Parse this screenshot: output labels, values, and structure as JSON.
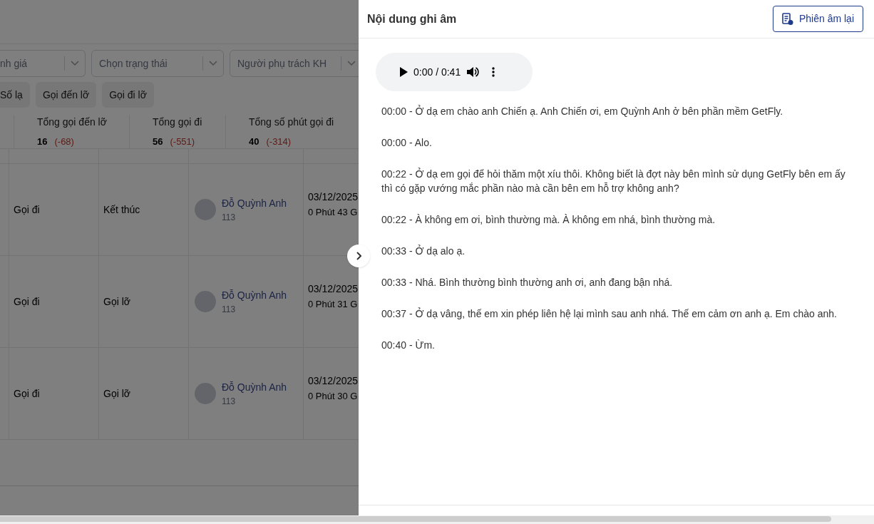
{
  "background_page": {
    "filters": [
      {
        "placeholder": "nh giá"
      },
      {
        "placeholder": "Chọn trạng thái"
      },
      {
        "placeholder": "Người phụ trách KH"
      }
    ],
    "quick_filters": [
      {
        "label": "Số lạ"
      },
      {
        "label": "Gọi đến lỡ"
      },
      {
        "label": "Gọi đi lỡ"
      }
    ],
    "stats": [
      {
        "label": "Tổng gọi đến lỡ",
        "value": "16",
        "change": "(-68)"
      },
      {
        "label": "Tổng gọi đi",
        "value": "56",
        "change": "(-551)"
      },
      {
        "label": "Tổng số phút gọi đi",
        "value": "40",
        "change": "(-314)"
      }
    ],
    "table": {
      "rows": [
        {
          "column_2": "Gọi đi",
          "column_3": "Kết thúc",
          "agent": {
            "name": "Đỗ Quỳnh Anh",
            "extension": "113"
          },
          "column_5": {
            "date": "03/12/2025",
            "duration": "0 Phút 43 G"
          }
        },
        {
          "column_2": "Gọi đi",
          "column_3": "Gọi lỡ",
          "agent": {
            "name": "Đỗ Quỳnh Anh",
            "extension": "113"
          },
          "column_5": {
            "date": "03/12/2025",
            "duration": "0 Phút 31 G"
          }
        },
        {
          "column_2": "Gọi đi",
          "column_3": "Gọi lỡ",
          "agent": {
            "name": "Đỗ Quỳnh Anh",
            "extension": "113"
          },
          "column_5": {
            "date": "03/12/2025",
            "duration": "0 Phút 30 G"
          }
        }
      ]
    }
  },
  "panel": {
    "title": "Nội dung ghi âm",
    "action_button": "Phiên âm lại",
    "audio": {
      "time": "0:00 / 0:41"
    },
    "transcript": [
      "00:00 - Ở dạ em chào anh Chiến ạ. Anh Chiến ơi, em Quỳnh Anh ở bên phần mềm GetFly.",
      "00:00 - Alo.",
      "00:22 - Ở dạ em gọi để hỏi thăm một xíu thôi. Không biết là đợt này bên mình sử dụng GetFly bên em ấy thì có gặp vướng mắc phần nào mà cần bên em hỗ trợ không anh?",
      "00:22 - À không em ơi, bình thường mà. À không em nhá, bình thường mà.",
      "00:33 - Ở dạ alo ạ.",
      "00:33 - Nhá. Bình thường bình thường anh ơi, anh đang bận nhá.",
      "00:37 - Ở dạ vâng, thế em xin phép liên hệ lại mình sau anh nhá. Thế em cảm ơn anh ạ. Em chào anh.",
      "00:40 - Ừm."
    ]
  }
}
